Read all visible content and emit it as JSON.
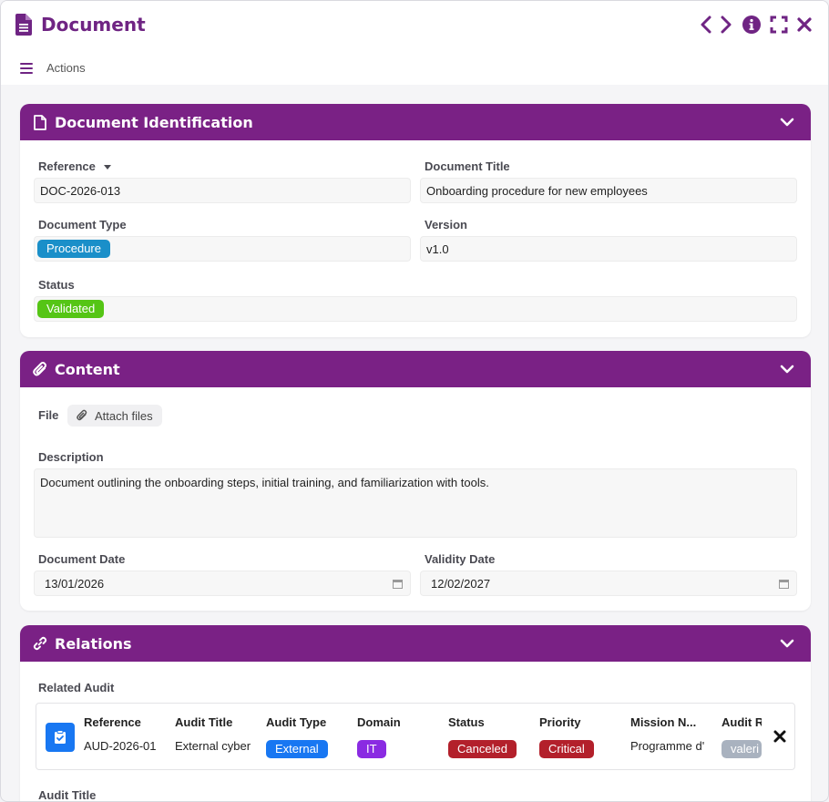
{
  "app": {
    "title": "Document",
    "actions_label": "Actions"
  },
  "colors": {
    "brand": "#7a2185",
    "procedure": "#1a8fc9",
    "validated": "#55c515",
    "external": "#1877f2",
    "domain_it": "#8a2be2",
    "canceled": "#b3202b",
    "critical": "#b3202b",
    "audit_response": "#a9b2bf"
  },
  "identification": {
    "title": "Document Identification",
    "reference_label": "Reference",
    "reference_value": "DOC-2026-013",
    "doc_title_label": "Document Title",
    "doc_title_value": "Onboarding procedure for new employees",
    "type_label": "Document Type",
    "type_value": "Procedure",
    "version_label": "Version",
    "version_value": "v1.0",
    "status_label": "Status",
    "status_value": "Validated"
  },
  "content": {
    "title": "Content",
    "file_label": "File",
    "attach_label": "Attach files",
    "description_label": "Description",
    "description_value": "Document outlining the onboarding steps, initial training, and familiarization with tools.",
    "doc_date_label": "Document Date",
    "doc_date_value": "13/01/2026",
    "validity_date_label": "Validity Date",
    "validity_date_value": "12/02/2027"
  },
  "relations": {
    "title": "Relations",
    "related_audit_label": "Related Audit",
    "audit": {
      "headers": [
        "Reference",
        "Audit Title",
        "Audit Type",
        "Domain",
        "Status",
        "Priority",
        "Mission N...",
        "Audit R"
      ],
      "reference": "AUD-2026-01",
      "audit_title": "External cyber",
      "audit_type": "External",
      "domain": "IT",
      "status": "Canceled",
      "priority": "Critical",
      "mission": "Programme d'",
      "audit_response": "valeri"
    },
    "audit_title_label": "Audit Title"
  }
}
